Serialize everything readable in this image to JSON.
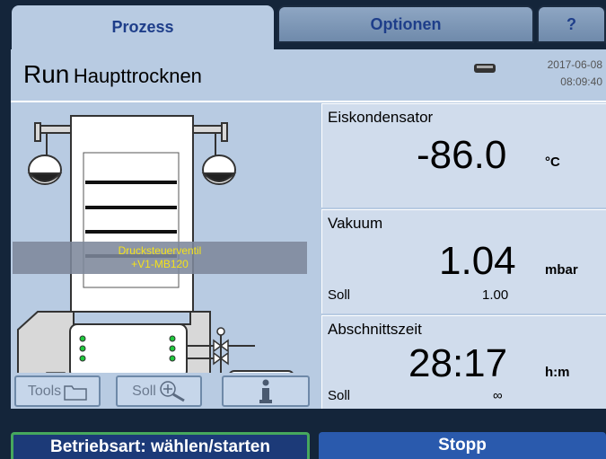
{
  "tabs": {
    "prozess": "Prozess",
    "optionen": "Optionen",
    "help": "?"
  },
  "header": {
    "mode": "Run",
    "phase": "Haupttrocknen",
    "date": "2017-06-08",
    "time": "08:09:40"
  },
  "diagram": {
    "tooltip_line1": "Drucksteuerventil",
    "tooltip_line2": "+V1-MB120"
  },
  "tool_buttons": {
    "tools": "Tools",
    "soll": "Soll",
    "info": "i"
  },
  "eiskondensator": {
    "label": "Eiskondensator",
    "value": "-86.0",
    "unit": "°C"
  },
  "vakuum": {
    "label": "Vakuum",
    "value": "1.04",
    "unit": "mbar",
    "soll_label": "Soll",
    "soll_value": "1.00"
  },
  "abschnittszeit": {
    "label": "Abschnittszeit",
    "value": "28:17",
    "unit": "h:m",
    "soll_label": "Soll",
    "soll_value": "∞"
  },
  "bottom": {
    "betriebsart": "Betriebsart: wählen/starten",
    "stopp": "Stopp"
  },
  "colors": {
    "panel": "#b8cbe2",
    "tooltip_text": "#f4e21a",
    "pump_green": "#1fc83c",
    "active_border": "#46a85d"
  }
}
